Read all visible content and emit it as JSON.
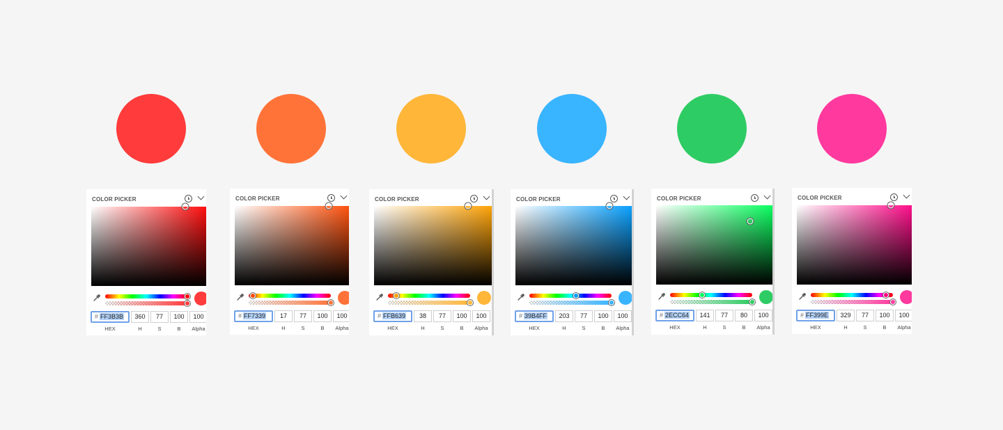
{
  "labels": {
    "header": "COLOR PICKER",
    "hash": "#",
    "hex": "HEX",
    "h": "H",
    "s": "S",
    "b": "B",
    "alpha": "Alpha"
  },
  "pickers": [
    {
      "hex": "FF3B3B",
      "h": "360",
      "s": "77",
      "b": "100",
      "alpha": "100",
      "color": "#ff3b3b"
    },
    {
      "hex": "FF7339",
      "h": "17",
      "s": "77",
      "b": "100",
      "alpha": "100",
      "color": "#ff7339"
    },
    {
      "hex": "FFB639",
      "h": "38",
      "s": "77",
      "b": "100",
      "alpha": "100",
      "color": "#ffb639"
    },
    {
      "hex": "39B4FF",
      "h": "203",
      "s": "77",
      "b": "100",
      "alpha": "100",
      "color": "#39b4ff"
    },
    {
      "hex": "2ECC64",
      "h": "141",
      "s": "77",
      "b": "80",
      "alpha": "100",
      "color": "#2ecc64"
    },
    {
      "hex": "FF399E",
      "h": "329",
      "s": "77",
      "b": "100",
      "alpha": "100",
      "color": "#ff399e"
    }
  ]
}
